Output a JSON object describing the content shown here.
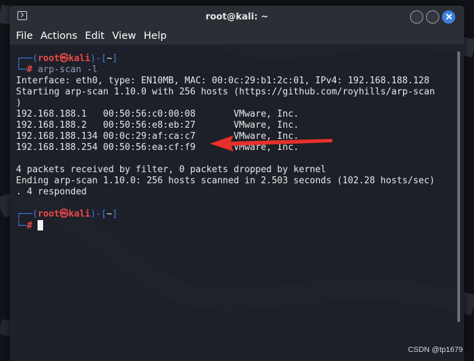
{
  "window": {
    "title": "root@kali: ~"
  },
  "menu": [
    "File",
    "Actions",
    "Edit",
    "View",
    "Help"
  ],
  "prompt": {
    "user": "root",
    "symbol": "㉿",
    "host": "kali",
    "dir": "~",
    "hash": "#"
  },
  "command": "arp-scan -l",
  "output": [
    "Interface: eth0, type: EN10MB, MAC: 00:0c:29:b1:2c:01, IPv4: 192.168.188.128",
    "Starting arp-scan 1.10.0 with 256 hosts (https://github.com/royhills/arp-scan",
    ")",
    "192.168.188.1   00:50:56:c0:00:08       VMware, Inc.",
    "192.168.188.2   00:50:56:e8:eb:27       VMware, Inc.",
    "192.168.188.134 00:0c:29:af:ca:c7       VMware, Inc.",
    "192.168.188.254 00:50:56:ea:cf:f9       VMware, Inc.",
    "",
    "4 packets received by filter, 0 packets dropped by kernel",
    "Ending arp-scan 1.10.0: 256 hosts scanned in 2.503 seconds (102.28 hosts/sec)",
    ". 4 responded"
  ],
  "watermark": "CSDN @tp1679",
  "colors": {
    "prompt_blue": "#3f7fe6",
    "prompt_red": "#f04848",
    "arrow_red": "#e8302a",
    "close_button": "#3d7fe0"
  }
}
